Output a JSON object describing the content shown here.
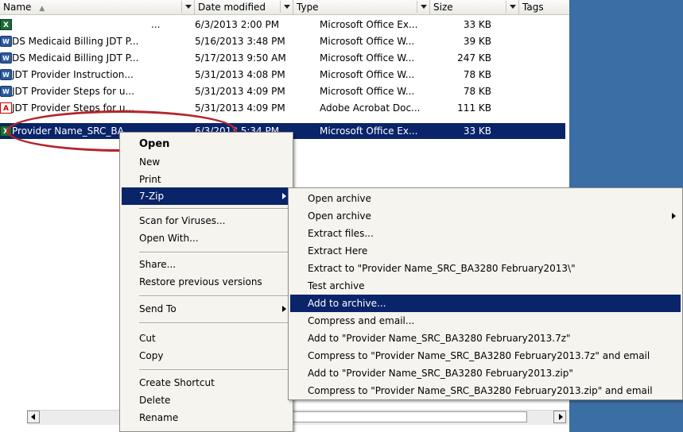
{
  "header": {
    "col_name": "Name",
    "col_date": "Date modified",
    "col_type": "Type",
    "col_size": "Size",
    "col_tags": "Tags"
  },
  "files": [
    {
      "name": "...",
      "date": "6/3/2013 2:00 PM",
      "type": "Microsoft Office Ex...",
      "size": "33 KB",
      "icon": "excel-icon"
    },
    {
      "name": "DS Medicaid Billing JDT P...",
      "date": "5/16/2013 3:48 PM",
      "type": "Microsoft Office W...",
      "size": "39 KB",
      "icon": "word-icon"
    },
    {
      "name": "DS Medicaid Billing JDT P...",
      "date": "5/17/2013 9:50 AM",
      "type": "Microsoft Office W...",
      "size": "247 KB",
      "icon": "word-icon"
    },
    {
      "name": "JDT Provider Instruction...",
      "date": "5/31/2013 4:08 PM",
      "type": "Microsoft Office W...",
      "size": "78 KB",
      "icon": "word-icon"
    },
    {
      "name": "JDT Provider Steps for u...",
      "date": "5/31/2013 4:09 PM",
      "type": "Microsoft Office W...",
      "size": "78 KB",
      "icon": "word-icon"
    },
    {
      "name": "JDT Provider Steps for u...",
      "date": "5/31/2013 4:09 PM",
      "type": "Adobe Acrobat Doc...",
      "size": "111 KB",
      "icon": "pdf-icon"
    },
    {
      "name": "Provider Name_SRC_BA",
      "date": "6/3/2013 5:34 PM",
      "type": "Microsoft Office Ex...",
      "size": "33 KB",
      "icon": "excel-icon"
    }
  ],
  "context_menu": {
    "open": "Open",
    "new": "New",
    "print": "Print",
    "seven_zip": "7-Zip",
    "scan": "Scan for Viruses...",
    "open_with": "Open With...",
    "share": "Share...",
    "restore": "Restore previous versions",
    "send_to": "Send To",
    "cut": "Cut",
    "copy": "Copy",
    "create_shortcut": "Create Shortcut",
    "delete": "Delete",
    "rename": "Rename"
  },
  "submenu": {
    "open_archive_1": "Open archive",
    "open_archive_2": "Open archive",
    "extract_files": "Extract files...",
    "extract_here": "Extract Here",
    "extract_to": "Extract to \"Provider Name_SRC_BA3280 February2013\\\"",
    "test_archive": "Test archive",
    "add_to_archive": "Add to archive...",
    "compress_email": "Compress and email...",
    "add_to_7z": "Add to \"Provider Name_SRC_BA3280 February2013.7z\"",
    "compress_7z_email": "Compress to \"Provider Name_SRC_BA3280 February2013.7z\" and email",
    "add_to_zip": "Add to \"Provider Name_SRC_BA3280 February2013.zip\"",
    "compress_zip_email": "Compress to \"Provider Name_SRC_BA3280 February2013.zip\" and email"
  },
  "colors": {
    "selection": "#0a246a",
    "desktop": "#3a6ea5",
    "annotation": "#b3252c",
    "menu_bg": "#f5f4ee"
  }
}
